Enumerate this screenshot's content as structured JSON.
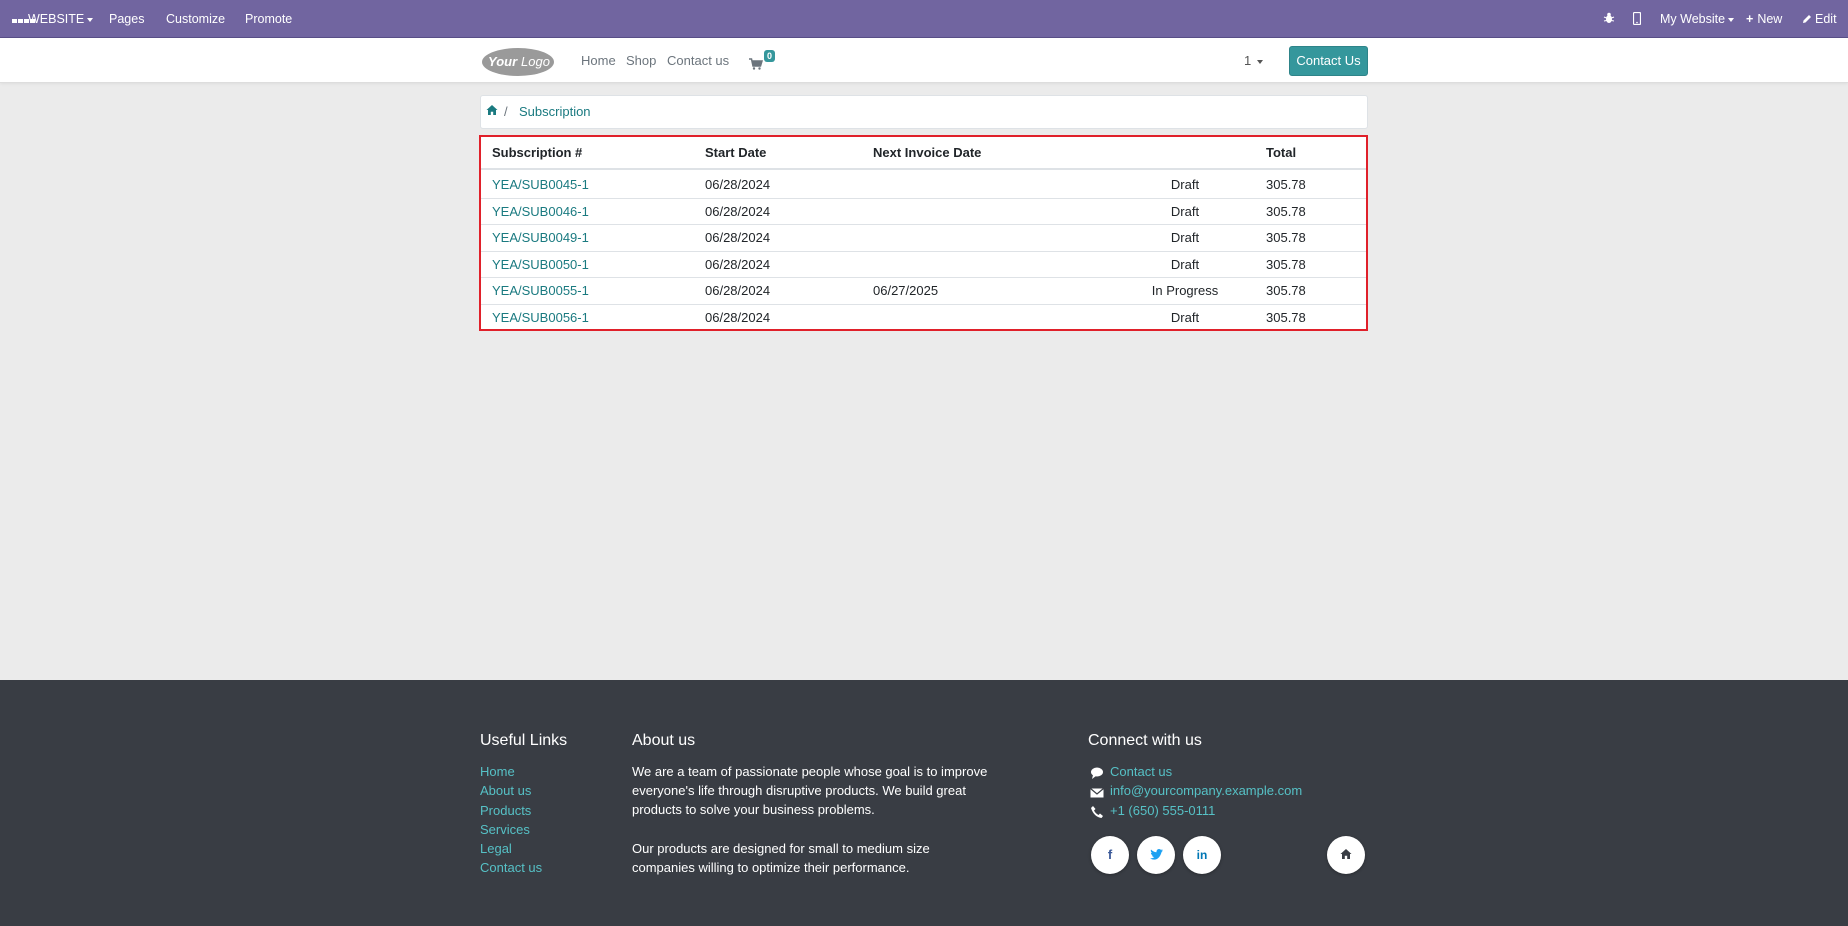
{
  "adminbar": {
    "website_menu": "WEBSITE",
    "pages": "Pages",
    "customize": "Customize",
    "promote": "Promote",
    "my_website": "My Website",
    "new": "New",
    "edit": "Edit"
  },
  "navbar": {
    "logo_text": "YourLogo",
    "links": [
      "Home",
      "Shop",
      "Contact us"
    ],
    "cart_count": "0",
    "language": "1",
    "contact_button": "Contact Us"
  },
  "breadcrumb": {
    "current": "Subscription"
  },
  "table": {
    "headers": [
      "Subscription #",
      "Start Date",
      "Next Invoice Date",
      "Total"
    ],
    "rows": [
      {
        "number": "YEA/SUB0045-1",
        "start": "06/28/2024",
        "next": "",
        "status": "Draft",
        "total": "305.78"
      },
      {
        "number": "YEA/SUB0046-1",
        "start": "06/28/2024",
        "next": "",
        "status": "Draft",
        "total": "305.78"
      },
      {
        "number": "YEA/SUB0049-1",
        "start": "06/28/2024",
        "next": "",
        "status": "Draft",
        "total": "305.78"
      },
      {
        "number": "YEA/SUB0050-1",
        "start": "06/28/2024",
        "next": "",
        "status": "Draft",
        "total": "305.78"
      },
      {
        "number": "YEA/SUB0055-1",
        "start": "06/28/2024",
        "next": "06/27/2025",
        "status": "In Progress",
        "total": "305.78"
      },
      {
        "number": "YEA/SUB0056-1",
        "start": "06/28/2024",
        "next": "",
        "status": "Draft",
        "total": "305.78"
      }
    ]
  },
  "footer": {
    "useful_links_title": "Useful Links",
    "useful_links": [
      "Home",
      "About us",
      "Products",
      "Services",
      "Legal",
      "Contact us"
    ],
    "about_title": "About us",
    "about_p1": "We are a team of passionate people whose goal is to improve everyone's life through disruptive products. We build great products to solve your business problems.",
    "about_p2": "Our products are designed for small to medium size companies willing to optimize their performance.",
    "connect_title": "Connect with us",
    "contact_link": "Contact us",
    "email": "info@yourcompany.example.com",
    "phone": "+1 (650) 555-0111",
    "social": {
      "facebook": "f",
      "linkedin": "in"
    }
  },
  "colors": {
    "admin_bar": "#7165a0",
    "accent": "#35979c",
    "link": "#1a7a80",
    "highlight_border": "#e0202a",
    "footer_bg": "#393d44",
    "footer_link": "#56c1c6"
  }
}
